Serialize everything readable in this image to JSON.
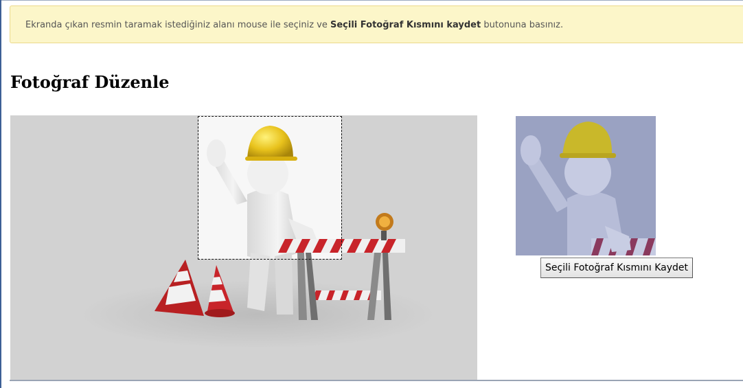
{
  "notice": {
    "text_before": "Ekranda çıkan resmin taramak istediğiniz alanı mouse ile seçiniz ve ",
    "text_bold": "Seçili Fotoğraf Kısmını kaydet",
    "text_after": " butonuna basınız."
  },
  "page": {
    "title": "Fotoğraf Düzenle"
  },
  "preview": {
    "save_label": "Seçili Fotoğraf Kısmını Kaydet"
  },
  "colors": {
    "notice_bg": "#fcf6c9",
    "helmet": "#e8c21c",
    "barrier_red": "#c8242a",
    "preview_tint": "#8f98c0"
  }
}
